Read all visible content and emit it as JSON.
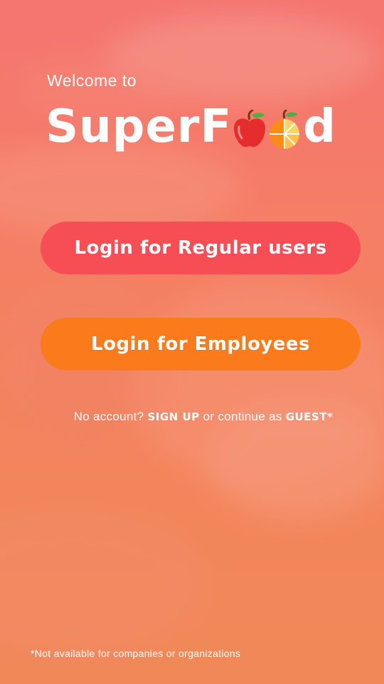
{
  "welcome": {
    "line1": "Welcome to",
    "brand_prefix": "SuperF",
    "brand_suffix": "d"
  },
  "icons": {
    "apple": "apple-icon",
    "orange": "orange-icon"
  },
  "buttons": {
    "regular_label": "Login for Regular users",
    "employee_label": "Login for Employees"
  },
  "signup": {
    "prefix": "No account?",
    "signup_link": "SIGN UP",
    "middle": "or continue as",
    "guest_link": "GUEST*"
  },
  "footnote": "*Not available for companies or organizations",
  "colors": {
    "regular_button": "#f74d55",
    "employee_button": "#fb7a1c",
    "text": "#ffffff"
  }
}
